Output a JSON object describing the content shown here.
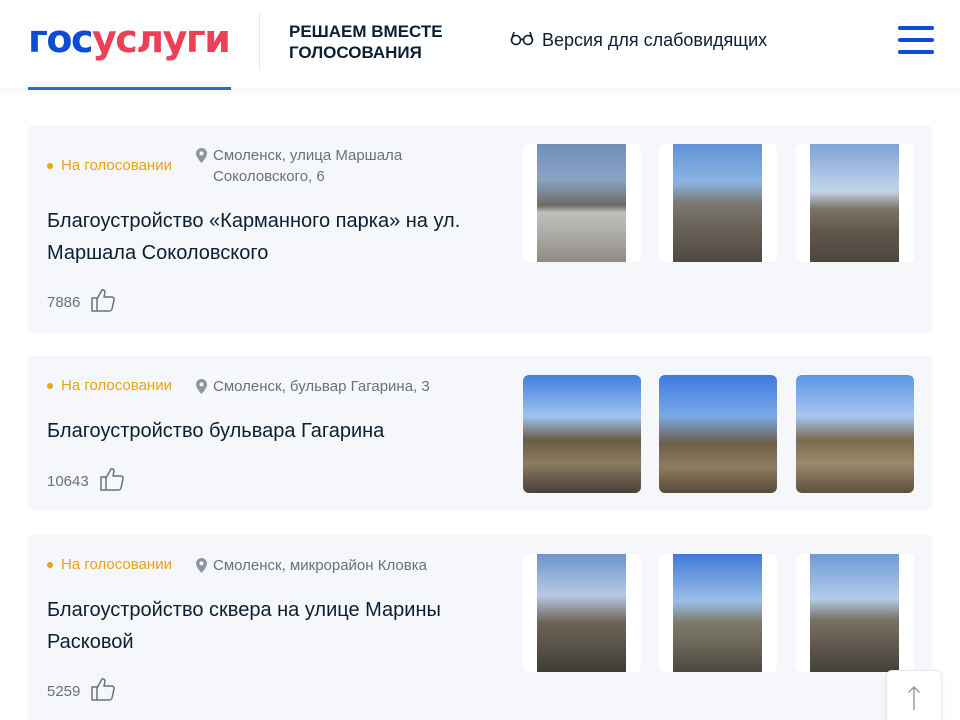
{
  "header": {
    "logo_part1": "гос",
    "logo_part2": "услуги",
    "project_line1": "Решаем вместе",
    "project_line2": "Голосования",
    "a11y_label": "Версия для слабовидящих"
  },
  "cards": [
    {
      "status": "На голосовании",
      "address": "Смоленск, улица Маршала Соколовского, 6",
      "title": "Благоустройство «Карманного парка» на ул. Маршала Соколовского",
      "votes": "7886",
      "photos": [
        "street-photo",
        "shadow-photo",
        "park-photo"
      ]
    },
    {
      "status": "На голосовании",
      "address": "Смоленск, бульвар Гагарина, 3",
      "title": "Благоустройство бульвара Гагарина",
      "votes": "10643",
      "photos": [
        "boulevard-photo",
        "trees-photo",
        "path-photo"
      ]
    },
    {
      "status": "На голосовании",
      "address": "Смоленск, микрорайон Кловка",
      "title": "Благоустройство сквера на улице Марины Расковой",
      "votes": "5259",
      "photos": [
        "birch-photo",
        "field-photo",
        "square-photo"
      ]
    }
  ],
  "icons": {
    "a11y": "glasses-icon",
    "pin": "location-pin-icon",
    "like": "thumbs-up-icon",
    "menu": "hamburger-menu-icon",
    "up": "arrow-up-icon"
  },
  "colors": {
    "brand_blue": "#0d4cd3",
    "brand_red": "#ee3f58",
    "status_orange": "#e8a317",
    "card_bg": "#f5f7fa"
  }
}
